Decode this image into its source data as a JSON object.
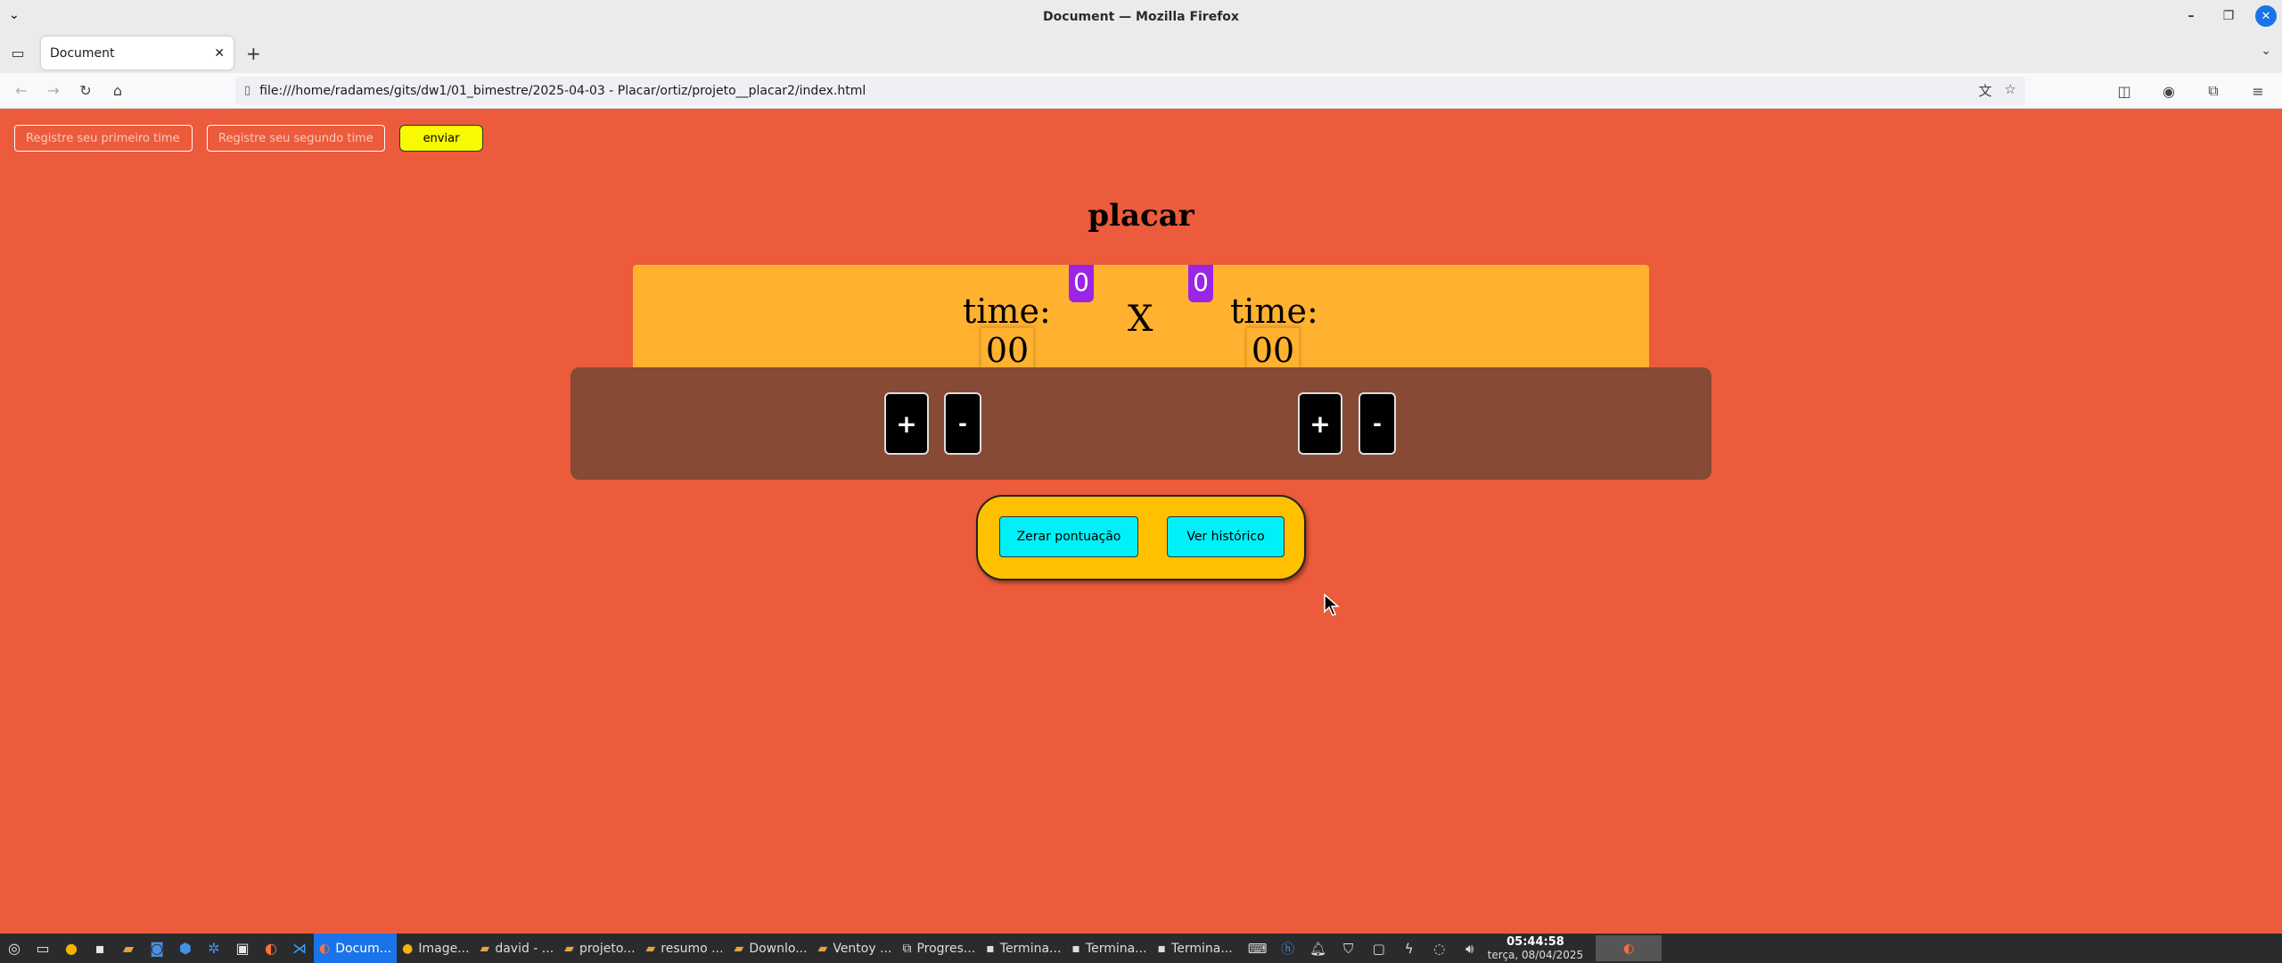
{
  "window": {
    "title": "Document — Mozilla Firefox",
    "menu_icon": "chevron-down-icon",
    "controls": [
      "minimize-icon",
      "restore-icon",
      "close-icon"
    ]
  },
  "tabs": {
    "items": [
      {
        "label": "Document",
        "active": true
      }
    ],
    "new_tab": "+",
    "list_icon": "tab-list-icon",
    "dropdown_icon": "chevron-down-icon"
  },
  "navigation": {
    "url": "file:///home/radames/gits/dw1/01_bimestre/2025-04-03 - Placar/ortiz/projeto__placar2/index.html",
    "back_enabled": false,
    "forward_enabled": false
  },
  "page": {
    "inputs": {
      "first_team_placeholder": "Registre seu primeiro time",
      "second_team_placeholder": "Registre seu segundo time",
      "first_team_value": "",
      "second_team_value": ""
    },
    "send_label": "enviar",
    "title": "placar",
    "scoreboard": {
      "team1": {
        "label": "time:",
        "badge": "0",
        "score": "00"
      },
      "team2": {
        "label": "time:",
        "badge": "0",
        "score": "00"
      },
      "versus": "X"
    },
    "controls": {
      "team1_plus": "+",
      "team1_minus": "-",
      "team2_plus": "+",
      "team2_minus": "-"
    },
    "actions": {
      "reset_label": "Zerar pontuação",
      "history_label": "Ver histórico"
    },
    "colors": {
      "background": "#ec5b3b",
      "scoreboard": "#ffb12f",
      "badge": "#9b24e5",
      "controls_panel": "#874a35",
      "action_panel": "#ffc000",
      "action_button": "#00f0f8",
      "send_button": "#f7fa00"
    }
  },
  "taskbar": {
    "tasks": [
      {
        "label": "Docum...",
        "active": true
      },
      {
        "label": "Image...",
        "active": false
      },
      {
        "label": "david - ...",
        "active": false
      },
      {
        "label": "projeto...",
        "active": false
      },
      {
        "label": "resumo ...",
        "active": false
      },
      {
        "label": "Downlo...",
        "active": false
      },
      {
        "label": "Ventoy ...",
        "active": false
      },
      {
        "label": "Progres...",
        "active": false
      },
      {
        "label": "Termina...",
        "active": false
      },
      {
        "label": "Termina...",
        "active": false
      },
      {
        "label": "Termina...",
        "active": false
      }
    ],
    "clock": {
      "time": "05:44:58",
      "date": "terça, 08/04/2025"
    }
  }
}
